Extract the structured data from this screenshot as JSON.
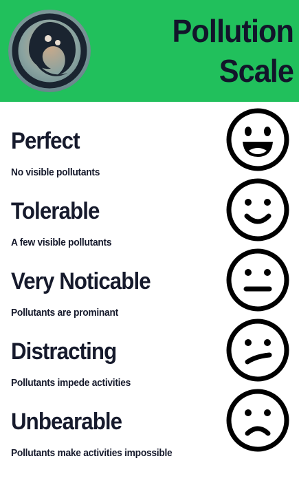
{
  "header": {
    "title_line1": "Pollution",
    "title_line2": "Scale",
    "logo_icon": "water-drop-wave-logo-icon",
    "background_color": "#21c05c"
  },
  "levels": [
    {
      "name": "Perfect",
      "description": "No visible pollutants",
      "face_icon": "grinning-face-icon"
    },
    {
      "name": "Tolerable",
      "description": "A few visible pollutants",
      "face_icon": "smiling-face-icon"
    },
    {
      "name": "Very Noticable",
      "description": "Pollutants are prominant",
      "face_icon": "neutral-face-icon"
    },
    {
      "name": "Distracting",
      "description": "Pollutants impede activities",
      "face_icon": "confused-face-icon"
    },
    {
      "name": "Unbearable",
      "description": "Pollutants  make activities impossible",
      "face_icon": "frowning-face-icon"
    }
  ],
  "colors": {
    "text": "#161a2c",
    "accent": "#21c05c"
  }
}
